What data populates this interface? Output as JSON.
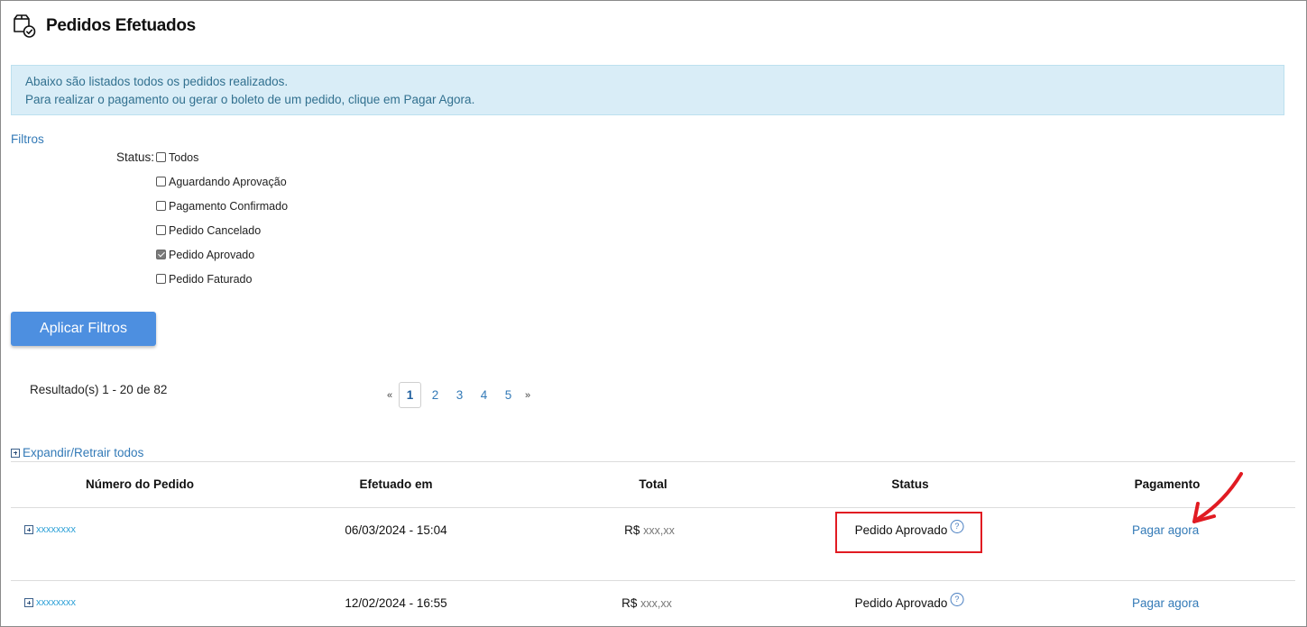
{
  "header": {
    "title": "Pedidos Efetuados",
    "icon": "orders-box-check-icon"
  },
  "info": {
    "line1": "Abaixo são listados todos os pedidos realizados.",
    "line2": "Para realizar o pagamento ou gerar o boleto de um pedido, clique em Pagar Agora."
  },
  "filters": {
    "title": "Filtros",
    "status_label": "Status:",
    "options": [
      {
        "label": "Todos",
        "checked": false
      },
      {
        "label": "Aguardando Aprovação",
        "checked": false
      },
      {
        "label": "Pagamento Confirmado",
        "checked": false
      },
      {
        "label": "Pedido Cancelado",
        "checked": false
      },
      {
        "label": "Pedido Aprovado",
        "checked": true
      },
      {
        "label": "Pedido Faturado",
        "checked": false
      }
    ],
    "apply_label": "Aplicar Filtros"
  },
  "results": {
    "text": "Resultado(s) 1 - 20 de 82"
  },
  "pagination": {
    "prev": "«",
    "next": "»",
    "pages": [
      "1",
      "2",
      "3",
      "4",
      "5"
    ],
    "active_page": "1"
  },
  "expand_all_label": "Expandir/Retrair todos",
  "table": {
    "headers": {
      "order_number": "Número do Pedido",
      "date": "Efetuado em",
      "total": "Total",
      "status": "Status",
      "payment": "Pagamento"
    },
    "rows": [
      {
        "order_number": "xxxxxxxx",
        "date": "06/03/2024 - 15:04",
        "total_currency": "R$",
        "total_amount": "xxx,xx",
        "status": "Pedido Aprovado",
        "payment": "Pagar agora",
        "highlighted": true
      },
      {
        "order_number": "xxxxxxxx",
        "date": "12/02/2024 - 16:55",
        "total_currency": "R$",
        "total_amount": "xxx,xx",
        "status": "Pedido Aprovado",
        "payment": "Pagar agora",
        "highlighted": false
      }
    ]
  },
  "help_icon_glyph": "?",
  "colors": {
    "link": "#337ab7",
    "info_bg": "#d9edf7",
    "info_text": "#31708f",
    "button_bg": "#4d8fe0",
    "highlight": "#e11b22"
  }
}
